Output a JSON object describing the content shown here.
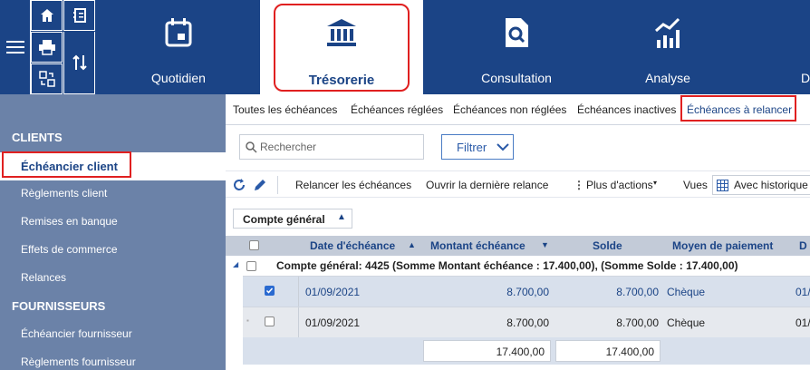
{
  "nav": {
    "modules": [
      {
        "label": "Quotidien",
        "icon": "calendar-icon"
      },
      {
        "label": "Trésorerie",
        "icon": "bank-icon"
      },
      {
        "label": "Consultation",
        "icon": "document-search-icon"
      },
      {
        "label": "Analyse",
        "icon": "chart-icon"
      },
      {
        "label": "D",
        "icon": ""
      }
    ]
  },
  "sidebar": {
    "clients_header": "CLIENTS",
    "clients": [
      "Échéancier client",
      "Règlements client",
      "Remises en banque",
      "Effets de commerce",
      "Relances"
    ],
    "suppliers_header": "FOURNISSEURS",
    "suppliers": [
      "Échéancier fournisseur",
      "Règlements fournisseur"
    ]
  },
  "tabs": [
    "Toutes les échéances",
    "Échéances réglées",
    "Échéances non réglées",
    "Échéances inactives",
    "Échéances à relancer"
  ],
  "search": {
    "placeholder": "Rechercher"
  },
  "filter": {
    "label": "Filtrer"
  },
  "toolbar": {
    "relancer": "Relancer les échéances",
    "ouvrir": "Ouvrir la dernière relance",
    "plus": "Plus d'actions",
    "vues": "Vues",
    "view_value": "Avec historique"
  },
  "group_pill": "Compte général",
  "table": {
    "columns": [
      "Date d'échéance",
      "Montant échéance",
      "Solde",
      "Moyen de paiement",
      "D"
    ],
    "group_label": "Compte général: 4425 (Somme Montant échéance : 17.400,00), (Somme Solde : 17.400,00)",
    "rows": [
      {
        "date": "01/09/2021",
        "montant": "8.700,00",
        "solde": "8.700,00",
        "moyen": "Chèque",
        "extra": "01/",
        "checked": true
      },
      {
        "date": "01/09/2021",
        "montant": "8.700,00",
        "solde": "8.700,00",
        "moyen": "Chèque",
        "extra": "01/",
        "checked": false
      }
    ],
    "totals": {
      "montant": "17.400,00",
      "solde": "17.400,00"
    }
  },
  "colors": {
    "nav_bg": "#1b4486",
    "sidebar_bg": "#6b82a8",
    "highlight": "#e02020",
    "link": "#1b4486"
  }
}
